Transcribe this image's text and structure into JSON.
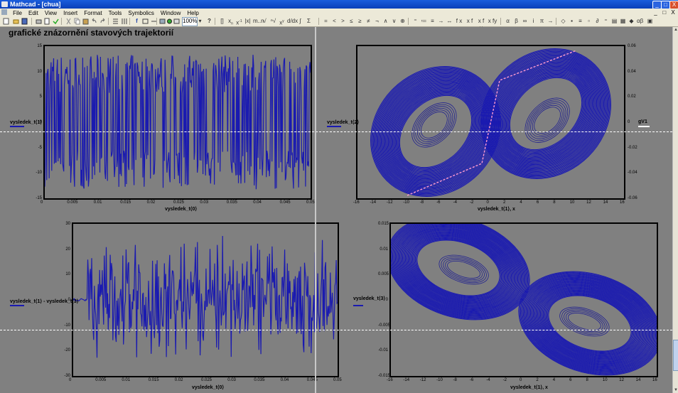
{
  "window": {
    "title": "Mathcad - [chua]",
    "buttons": [
      "_",
      "□",
      "X"
    ]
  },
  "menubar": {
    "items": [
      "File",
      "Edit",
      "View",
      "Insert",
      "Format",
      "Tools",
      "Symbolics",
      "Window",
      "Help"
    ],
    "mdi_buttons": [
      "_",
      "□",
      "X"
    ]
  },
  "toolbar": {
    "zoom": "100%",
    "symbols": [
      "=",
      "<",
      ">",
      "≤",
      "≥",
      "≠",
      "¬",
      "∧",
      "∨",
      "⊕",
      "⁼",
      "≔",
      "≡",
      "→",
      "↔",
      "f x",
      "x f",
      "x f y",
      "x fy"
    ]
  },
  "document": {
    "heading": "grafické znázornění stavových trajektorií"
  },
  "icons": {
    "new": "new-doc-icon",
    "open": "open-icon",
    "save": "save-icon",
    "print": "print-icon",
    "preview": "print-preview-icon",
    "spell": "spellcheck-icon",
    "cut": "cut-icon",
    "copy": "copy-icon",
    "paste": "paste-icon",
    "undo": "undo-icon",
    "redo": "redo-icon",
    "help": "help-icon"
  },
  "colors": {
    "trace": "#1a1ab0",
    "separatrix": "#ff9ad0",
    "background": "#808080",
    "titlebar": "#0a3fb8"
  },
  "chart_data": [
    {
      "type": "line",
      "id": "plot1",
      "xlabel": "vysledek_t⟨0⟩",
      "ylabel": "vysledek_t⟨1⟩",
      "xticks": [
        "0",
        "0.005",
        "0.01",
        "0.015",
        "0.02",
        "0.025",
        "0.03",
        "0.035",
        "0.04",
        "0.045",
        "0.05"
      ],
      "yticks": [
        "15",
        "10",
        "5",
        "0",
        "-5",
        "-10",
        "-15"
      ],
      "xlim": [
        0,
        0.05
      ],
      "ylim": [
        -15,
        15
      ],
      "series": [
        {
          "legend": true,
          "description": "rapid oscillation between approx -12 and 12"
        }
      ]
    },
    {
      "type": "line",
      "id": "plot2",
      "xlabel": "vysledek_t⟨1⟩, x",
      "ylabel": "vysledek_t⟨2⟩",
      "right_label": "gV1",
      "xticks": [
        "-16",
        "-14",
        "-12",
        "-10",
        "-8",
        "-6",
        "-4",
        "-2",
        "0",
        "2",
        "4",
        "6",
        "8",
        "10",
        "12",
        "14",
        "16"
      ],
      "yticks_right": [
        "0.06",
        "0.04",
        "0.02",
        "0",
        "-0.02",
        "-0.04",
        "-0.06"
      ],
      "xlim": [
        -16,
        16
      ],
      "ylim": [
        -0.06,
        0.06
      ]
    },
    {
      "type": "line",
      "id": "plot3",
      "xlabel": "vysledek_t⟨0⟩",
      "ylabel": "vysledek_t⟨1⟩ - vysledek_t⟨3⟩",
      "xticks": [
        "0",
        "0.005",
        "0.01",
        "0.015",
        "0.02",
        "0.025",
        "0.03",
        "0.035",
        "0.04",
        "0.045",
        "0.05"
      ],
      "yticks": [
        "30",
        "20",
        "10",
        "0",
        "-10",
        "-20",
        "-30"
      ],
      "xlim": [
        0,
        0.05
      ],
      "ylim": [
        -30,
        30
      ]
    },
    {
      "type": "line",
      "id": "plot4",
      "xlabel": "vysledek_t⟨1⟩, x",
      "ylabel": "vysledek_t⟨3⟩",
      "xticks": [
        "-16",
        "-14",
        "-12",
        "-10",
        "-8",
        "-6",
        "-4",
        "-2",
        "0",
        "2",
        "4",
        "6",
        "8",
        "10",
        "12",
        "14",
        "16"
      ],
      "yticks": [
        "0.015",
        "0.01",
        "0.005",
        "0",
        "-0.005",
        "-0.01",
        "-0.015"
      ],
      "xlim": [
        -16,
        16
      ],
      "ylim": [
        -0.015,
        0.015
      ]
    }
  ]
}
